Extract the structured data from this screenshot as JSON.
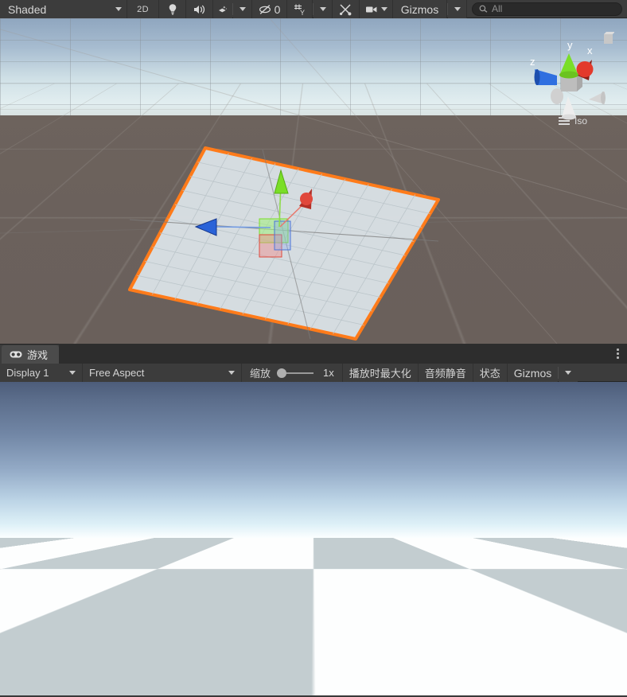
{
  "scene_toolbar": {
    "shading_mode": "Shaded",
    "mode_2d": "2D",
    "lighting_icon": "lightbulb-icon",
    "audio_icon": "speaker-icon",
    "fx_icon": "effects-icon",
    "hidden_count": "0",
    "hidden_icon": "eye-off-icon",
    "grid_icon": "grid-snap-icon",
    "tools_icon": "tools-icon",
    "camera_icon": "camera-icon",
    "gizmos_label": "Gizmos",
    "search_placeholder": "All",
    "search_value": "",
    "search_icon": "search-icon"
  },
  "scene_view": {
    "gizmo_axes": {
      "x": "x",
      "y": "y",
      "z": "z"
    },
    "projection_label": "Iso",
    "selection_outline_color": "#ff7b1a",
    "ground_color": "#6b615c",
    "axis_x_color": "#e0483c",
    "axis_y_color": "#7ade27",
    "axis_z_color": "#2a63d8",
    "selected_object": "Plane"
  },
  "game_panel": {
    "tab_label": "游戏",
    "tab_icon": "gamepad-icon",
    "kebab_icon": "kebab-menu-icon",
    "display": "Display 1",
    "aspect": "Free Aspect",
    "scale_label": "缩放",
    "scale_value": "1x",
    "maximize_on_play": "播放时最大化",
    "mute_audio": "音频静音",
    "stats": "状态",
    "gizmos": "Gizmos"
  },
  "colors": {
    "panel_bg": "#3c3c3c",
    "tab_active": "#4b4b4b",
    "text": "#d3d3d3",
    "sky_top": "#4d5d7a",
    "sky_horizon": "#ffffff",
    "checker_dark": "#c3cdd0",
    "checker_light": "#fdfefe"
  }
}
